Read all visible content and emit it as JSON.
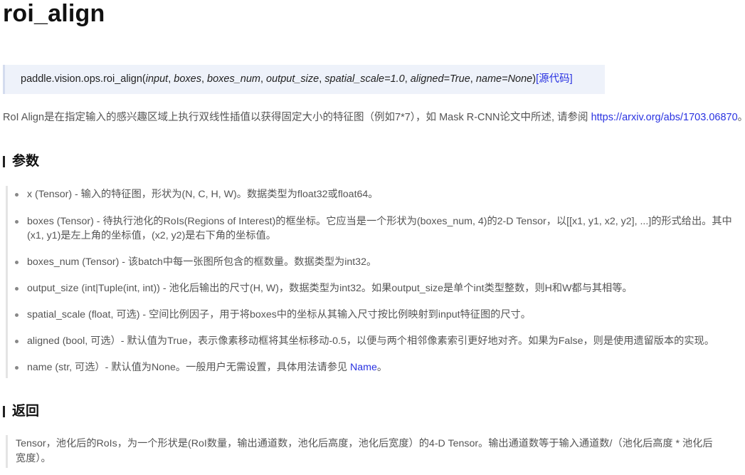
{
  "title": "roi_align",
  "signature": {
    "func": "paddle.vision.ops.roi_align(",
    "args": [
      {
        "text": "input",
        "italic": true
      },
      {
        "text": ", ",
        "italic": false
      },
      {
        "text": "boxes",
        "italic": true
      },
      {
        "text": ", ",
        "italic": false
      },
      {
        "text": "boxes_num",
        "italic": true
      },
      {
        "text": ", ",
        "italic": false
      },
      {
        "text": "output_size",
        "italic": true
      },
      {
        "text": ", ",
        "italic": false
      },
      {
        "text": "spatial_scale=1.0",
        "italic": true
      },
      {
        "text": ", ",
        "italic": false
      },
      {
        "text": "aligned=True",
        "italic": true
      },
      {
        "text": ", ",
        "italic": false
      },
      {
        "text": "name=None",
        "italic": true
      }
    ],
    "close": ")",
    "source_link": "[源代码]"
  },
  "intro": {
    "text": "RoI Align是在指定输入的感兴趣区域上执行双线性插值以获得固定大小的特征图（例如7*7），如 Mask R-CNN论文中所述, 请参阅 ",
    "link": "https://arxiv.org/abs/1703.06870",
    "suffix": "。"
  },
  "params_heading": "参数",
  "params": [
    {
      "text": "x (Tensor) - 输入的特征图，形状为(N, C, H, W)。数据类型为float32或float64。"
    },
    {
      "text": "boxes (Tensor) - 待执行池化的RoIs(Regions of Interest)的框坐标。它应当是一个形状为(boxes_num, 4)的2-D Tensor，以[[x1, y1, x2, y2], ...]的形式给出。其中(x1, y1)是左上角的坐标值，(x2, y2)是右下角的坐标值。"
    },
    {
      "text": "boxes_num (Tensor) - 该batch中每一张图所包含的框数量。数据类型为int32。"
    },
    {
      "text": "output_size (int|Tuple(int, int)) - 池化后输出的尺寸(H, W)，数据类型为int32。如果output_size是单个int类型整数，则H和W都与其相等。"
    },
    {
      "text": "spatial_scale (float, 可选) - 空间比例因子，用于将boxes中的坐标从其输入尺寸按比例映射到input特征图的尺寸。"
    },
    {
      "text": "aligned (bool, 可选）- 默认值为True，表示像素移动框将其坐标移动-0.5，以便与两个相邻像素索引更好地对齐。如果为False，则是使用遗留版本的实现。"
    },
    {
      "text": "name (str, 可选）- 默认值为None。一般用户无需设置，具体用法请参见 ",
      "link": "Name",
      "suffix": "。"
    }
  ],
  "returns_heading": "返回",
  "returns_text": "Tensor，池化后的RoIs，为一个形状是(RoI数量，输出通道数，池化后高度，池化后宽度）的4-D Tensor。输出通道数等于输入通道数/（池化后高度 * 池化后宽度）。",
  "colors": {
    "link": "#2932e1",
    "signature_bg": "#eef2fa",
    "text": "#555555",
    "heading": "#111111"
  }
}
